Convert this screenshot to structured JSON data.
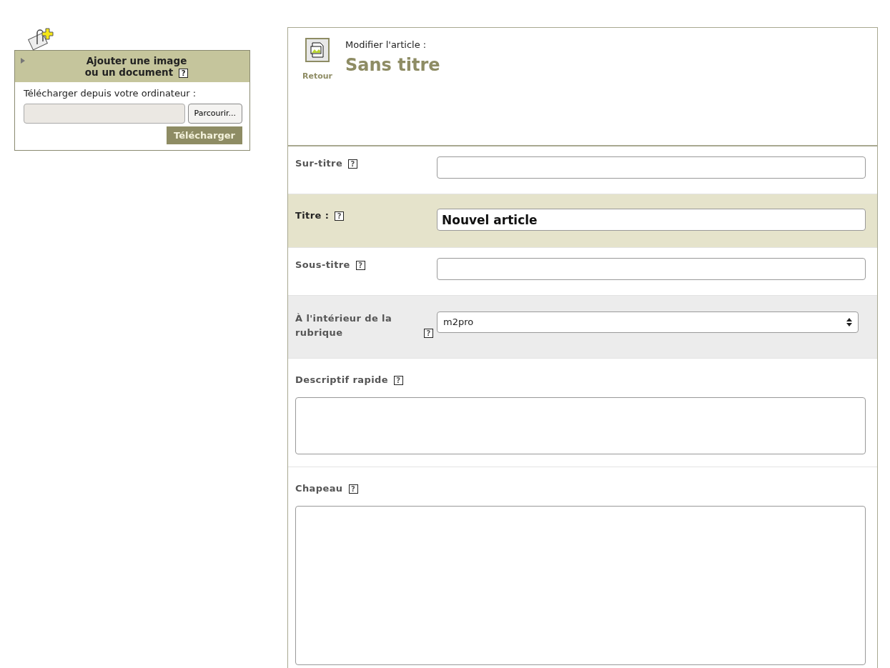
{
  "upload_box": {
    "title_lines": [
      "Ajouter une image",
      "ou un document"
    ],
    "help": "?",
    "label": "Télécharger depuis votre ordinateur :",
    "browse_button": "Parcourir...",
    "submit_button": "Télécharger"
  },
  "header": {
    "back_label": "Retour",
    "subtitle": "Modifier l'article :",
    "title": "Sans titre"
  },
  "fields": [
    {
      "kind": "input",
      "label": "Sur-titre",
      "help": "?",
      "color": "#ffffff"
    },
    {
      "kind": "input",
      "label": "Titre :",
      "help": "?",
      "value": "Nouvel article",
      "color": "#e5e3cb"
    },
    {
      "kind": "input",
      "label": "Sous-titre",
      "help": "?",
      "color": "#ffffff"
    },
    {
      "kind": "select",
      "label": "À l'intérieur de la rubrique",
      "help": "?",
      "value": "m2pro",
      "color": "#ececec"
    },
    {
      "kind": "textarea",
      "label": "Descriptif rapide",
      "help": "?",
      "color": "#ffffff"
    },
    {
      "kind": "textarea_large",
      "label": "Chapeau",
      "help": "?",
      "color": "#ffffff"
    }
  ]
}
